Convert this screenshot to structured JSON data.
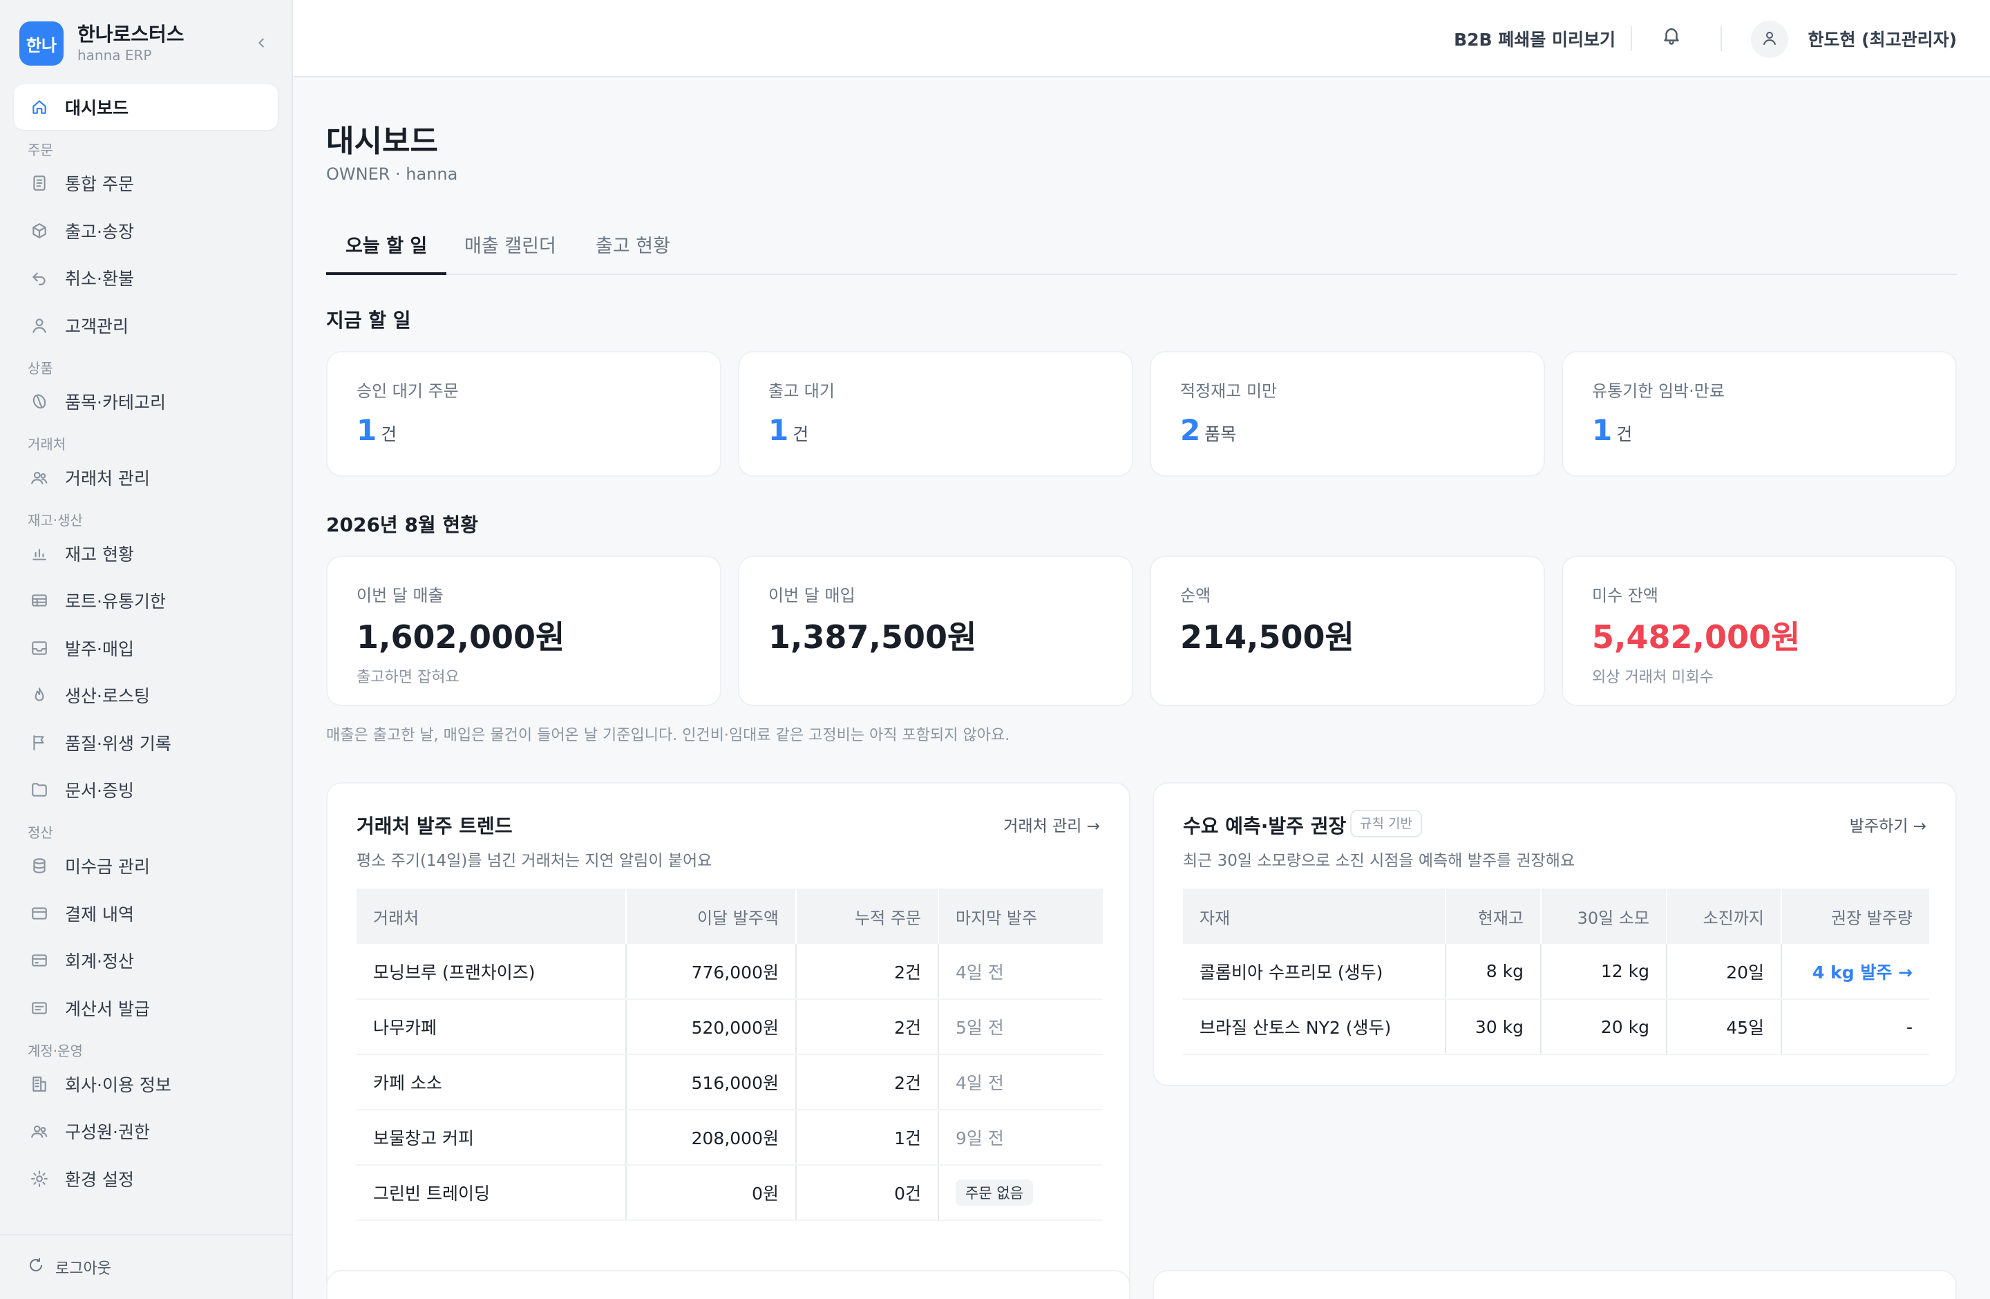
{
  "brand": {
    "logo": "한나",
    "name": "한나로스터스",
    "sub": "hanna ERP"
  },
  "nav": {
    "dashboard": "대시보드",
    "sec_order": "주문",
    "orders": "통합 주문",
    "shipping": "출고·송장",
    "refund": "취소·환불",
    "customers": "고객관리",
    "sec_product": "상품",
    "items": "품목·카테고리",
    "sec_partner": "거래처",
    "partners": "거래처 관리",
    "sec_stock": "재고·생산",
    "stock": "재고 현황",
    "lots": "로트·유통기한",
    "purchase": "발주·매입",
    "roasting": "생산·로스팅",
    "quality": "품질·위생 기록",
    "documents": "문서·증빙",
    "sec_settle": "정산",
    "receivables": "미수금 관리",
    "payments": "결제 내역",
    "accounting": "회계·정산",
    "invoices": "계산서 발급",
    "sec_account": "계정·운영",
    "company": "회사·이용 정보",
    "members": "구성원·권한",
    "settings": "환경 설정",
    "logout": "로그아웃"
  },
  "topbar": {
    "preview": "B2B 폐쇄몰 미리보기",
    "user": "한도현 (최고관리자)"
  },
  "page": {
    "title": "대시보드",
    "sub": "OWNER · hanna"
  },
  "tabs": [
    "오늘 할 일",
    "매출 캘린더",
    "출고 현황"
  ],
  "todo": {
    "title": "지금 할 일",
    "cards": [
      {
        "label": "승인 대기 주문",
        "value": "1",
        "unit": "건"
      },
      {
        "label": "출고 대기",
        "value": "1",
        "unit": "건"
      },
      {
        "label": "적정재고 미만",
        "value": "2",
        "unit": "품목"
      },
      {
        "label": "유통기한 임박·만료",
        "value": "1",
        "unit": "건"
      }
    ]
  },
  "month": {
    "title": "2026년 8월 현황",
    "cards": [
      {
        "label": "이번 달 매출",
        "value": "1,602,000원",
        "hint": "출고하면 잡혀요"
      },
      {
        "label": "이번 달 매입",
        "value": "1,387,500원",
        "hint": ""
      },
      {
        "label": "순액",
        "value": "214,500원",
        "hint": ""
      },
      {
        "label": "미수 잔액",
        "value": "5,482,000원",
        "hint": "외상 거래처 미회수"
      }
    ],
    "footnote": "매출은 출고한 날, 매입은 물건이 들어온 날 기준입니다. 인건비·임대료 같은 고정비는 아직 포함되지 않아요."
  },
  "trend": {
    "title": "거래처 발주 트렌드",
    "link": "거래처 관리 →",
    "sub": "평소 주기(14일)를 넘긴 거래처는 지연 알림이 붙어요",
    "headers": [
      "거래처",
      "이달 발주액",
      "누적 주문",
      "마지막 발주"
    ],
    "rows": [
      [
        "모닝브루 (프랜차이즈)",
        "776,000원",
        "2건",
        "4일 전"
      ],
      [
        "나무카페",
        "520,000원",
        "2건",
        "5일 전"
      ],
      [
        "카페 소소",
        "516,000원",
        "2건",
        "4일 전"
      ],
      [
        "보물창고 커피",
        "208,000원",
        "1건",
        "9일 전"
      ],
      [
        "그린빈 트레이딩",
        "0원",
        "0건",
        "주문 없음"
      ]
    ]
  },
  "forecast": {
    "title": "수요 예측·발주 권장",
    "badge": "규칙 기반",
    "link": "발주하기 →",
    "sub": "최근 30일 소모량으로 소진 시점을 예측해 발주를 권장해요",
    "headers": [
      "자재",
      "현재고",
      "30일 소모",
      "소진까지",
      "권장 발주량"
    ],
    "rows": [
      [
        "콜롬비아 수프리모 (생두)",
        "8 kg",
        "12 kg",
        "20일",
        "4 kg 발주 →"
      ],
      [
        "브라질 산토스 NY2 (생두)",
        "30 kg",
        "20 kg",
        "45일",
        "-"
      ]
    ]
  },
  "colors": {
    "accent": "#3182f6",
    "danger": "#f04452",
    "sidebar": "#f2f3f5"
  }
}
